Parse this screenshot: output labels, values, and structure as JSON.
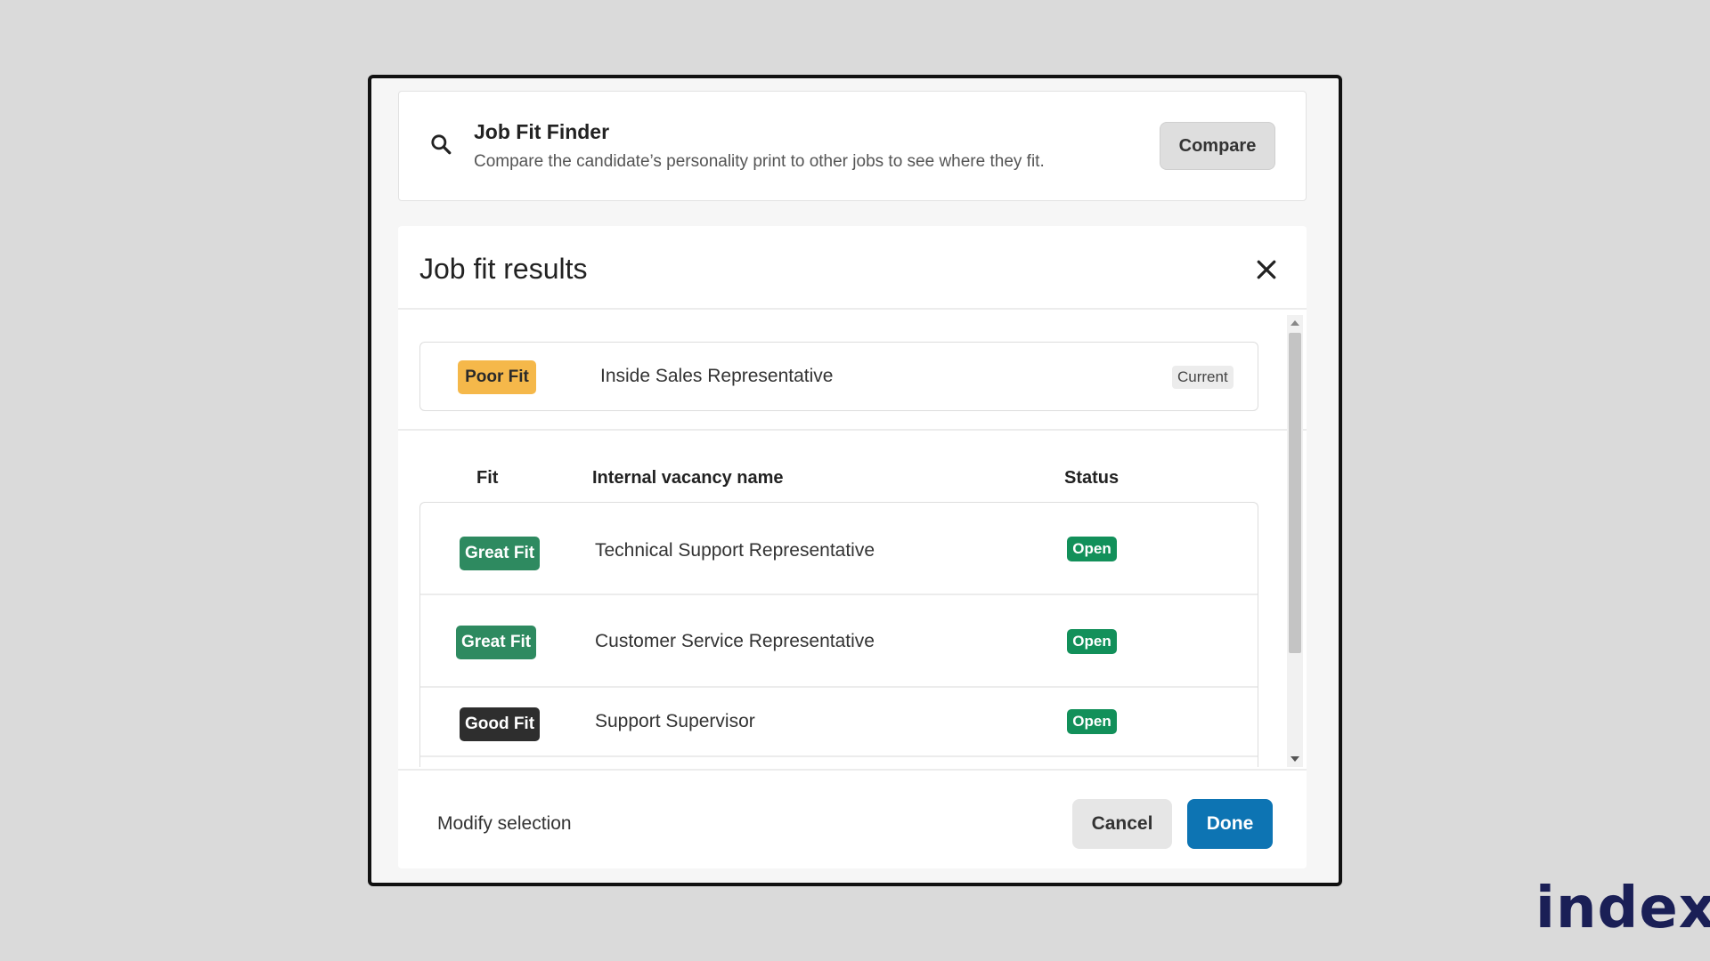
{
  "finder": {
    "title": "Job Fit Finder",
    "subtitle": "Compare the candidate’s personality print to other jobs to see where they fit.",
    "compare_label": "Compare",
    "icon": "search-icon"
  },
  "results": {
    "title": "Job fit results",
    "close_icon": "close-icon",
    "current_job": {
      "fit": "Poor Fit",
      "name": "Inside Sales Representative",
      "tag": "Current"
    },
    "columns": {
      "fit": "Fit",
      "name": "Internal vacancy name",
      "status": "Status"
    },
    "rows": [
      {
        "fit": "Great Fit",
        "name": "Technical Support Representative",
        "status": "Open"
      },
      {
        "fit": "Great Fit",
        "name": "Customer Service Representative",
        "status": "Open"
      },
      {
        "fit": "Good Fit",
        "name": "Support Supervisor",
        "status": "Open"
      }
    ],
    "footer": {
      "modify_label": "Modify selection",
      "cancel_label": "Cancel",
      "done_label": "Done"
    }
  },
  "brand": {
    "name": "index",
    "dot": ".",
    "colors": {
      "text": "#1a1f56",
      "dot": "#ee5a24"
    }
  },
  "colors": {
    "poor_fit": "#f5b84a",
    "great_fit": "#2e8a60",
    "good_fit": "#2e2e2e",
    "open_status": "#12905a",
    "primary_button": "#0d74b3"
  }
}
